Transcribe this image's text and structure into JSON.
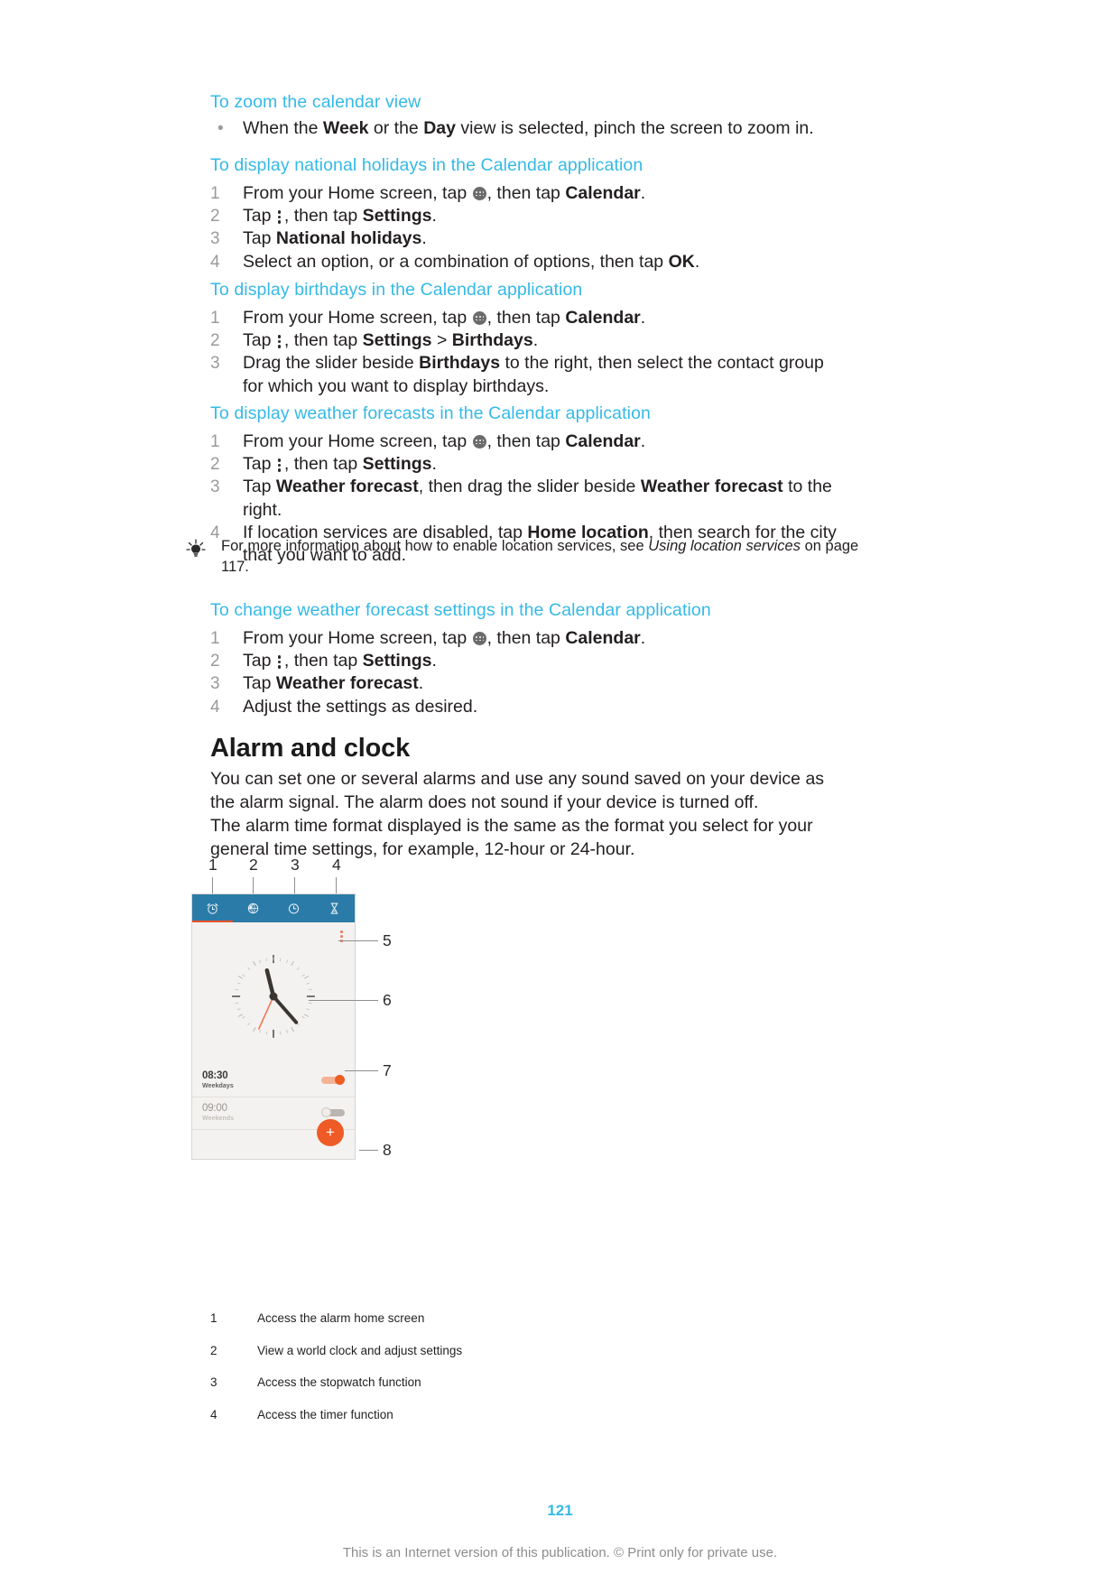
{
  "colors": {
    "heading_teal": "#36b9e6",
    "body_text": "#231f20",
    "step_number": "#9a9a9a",
    "phone_tabbar": "#2b7ba8",
    "accent_orange": "#ee5b26",
    "footer_gray": "#8d8d8d"
  },
  "sections": [
    {
      "id": "zoom-calendar-view",
      "heading": "To zoom the calendar view",
      "list_type": "bullet",
      "steps": [
        {
          "parts": [
            {
              "t": "text",
              "v": "When the "
            },
            {
              "t": "bold",
              "v": "Week"
            },
            {
              "t": "text",
              "v": " or the "
            },
            {
              "t": "bold",
              "v": "Day"
            },
            {
              "t": "text",
              "v": " view is selected, pinch the screen to zoom in."
            }
          ]
        }
      ]
    },
    {
      "id": "national-holidays",
      "heading": "To display national holidays in the Calendar application",
      "list_type": "numbered",
      "steps": [
        {
          "num": "1",
          "parts": [
            {
              "t": "text",
              "v": "From your Home screen, tap "
            },
            {
              "t": "icon",
              "v": "app-grid-icon"
            },
            {
              "t": "text",
              "v": ", then tap "
            },
            {
              "t": "bold",
              "v": "Calendar"
            },
            {
              "t": "text",
              "v": "."
            }
          ]
        },
        {
          "num": "2",
          "parts": [
            {
              "t": "text",
              "v": "Tap "
            },
            {
              "t": "icon",
              "v": "overflow-menu-icon"
            },
            {
              "t": "text",
              "v": ", then tap "
            },
            {
              "t": "bold",
              "v": "Settings"
            },
            {
              "t": "text",
              "v": "."
            }
          ]
        },
        {
          "num": "3",
          "parts": [
            {
              "t": "text",
              "v": "Tap "
            },
            {
              "t": "bold",
              "v": "National holidays"
            },
            {
              "t": "text",
              "v": "."
            }
          ]
        },
        {
          "num": "4",
          "parts": [
            {
              "t": "text",
              "v": "Select an option, or a combination of options, then tap "
            },
            {
              "t": "bold",
              "v": "OK"
            },
            {
              "t": "text",
              "v": "."
            }
          ]
        }
      ]
    },
    {
      "id": "birthdays",
      "heading": "To display birthdays in the Calendar application",
      "list_type": "numbered",
      "steps": [
        {
          "num": "1",
          "parts": [
            {
              "t": "text",
              "v": "From your Home screen, tap "
            },
            {
              "t": "icon",
              "v": "app-grid-icon"
            },
            {
              "t": "text",
              "v": ", then tap "
            },
            {
              "t": "bold",
              "v": "Calendar"
            },
            {
              "t": "text",
              "v": "."
            }
          ]
        },
        {
          "num": "2",
          "parts": [
            {
              "t": "text",
              "v": "Tap "
            },
            {
              "t": "icon",
              "v": "overflow-menu-icon"
            },
            {
              "t": "text",
              "v": ", then tap "
            },
            {
              "t": "bold",
              "v": "Settings"
            },
            {
              "t": "text",
              "v": " > "
            },
            {
              "t": "bold",
              "v": "Birthdays"
            },
            {
              "t": "text",
              "v": "."
            }
          ]
        },
        {
          "num": "3",
          "parts": [
            {
              "t": "text",
              "v": "Drag the slider beside "
            },
            {
              "t": "bold",
              "v": "Birthdays"
            },
            {
              "t": "text",
              "v": " to the right, then select the contact group for which you want to display birthdays."
            }
          ]
        }
      ]
    },
    {
      "id": "weather-forecasts",
      "heading": "To display weather forecasts in the Calendar application",
      "list_type": "numbered",
      "steps": [
        {
          "num": "1",
          "parts": [
            {
              "t": "text",
              "v": "From your Home screen, tap "
            },
            {
              "t": "icon",
              "v": "app-grid-icon"
            },
            {
              "t": "text",
              "v": ", then tap "
            },
            {
              "t": "bold",
              "v": "Calendar"
            },
            {
              "t": "text",
              "v": "."
            }
          ]
        },
        {
          "num": "2",
          "parts": [
            {
              "t": "text",
              "v": "Tap "
            },
            {
              "t": "icon",
              "v": "overflow-menu-icon"
            },
            {
              "t": "text",
              "v": ", then tap "
            },
            {
              "t": "bold",
              "v": "Settings"
            },
            {
              "t": "text",
              "v": "."
            }
          ]
        },
        {
          "num": "3",
          "parts": [
            {
              "t": "text",
              "v": "Tap "
            },
            {
              "t": "bold",
              "v": "Weather forecast"
            },
            {
              "t": "text",
              "v": ", then drag the slider beside "
            },
            {
              "t": "bold",
              "v": "Weather forecast"
            },
            {
              "t": "text",
              "v": " to the right."
            }
          ]
        },
        {
          "num": "4",
          "parts": [
            {
              "t": "text",
              "v": "If location services are disabled, tap "
            },
            {
              "t": "bold",
              "v": "Home location"
            },
            {
              "t": "text",
              "v": ", then search for the city that you want to add."
            }
          ]
        }
      ]
    },
    {
      "id": "change-weather-forecast-settings",
      "heading": "To change weather forecast settings in the Calendar application",
      "list_type": "numbered",
      "steps": [
        {
          "num": "1",
          "parts": [
            {
              "t": "text",
              "v": "From your Home screen, tap "
            },
            {
              "t": "icon",
              "v": "app-grid-icon"
            },
            {
              "t": "text",
              "v": ", then tap "
            },
            {
              "t": "bold",
              "v": "Calendar"
            },
            {
              "t": "text",
              "v": "."
            }
          ]
        },
        {
          "num": "2",
          "parts": [
            {
              "t": "text",
              "v": "Tap "
            },
            {
              "t": "icon",
              "v": "overflow-menu-icon"
            },
            {
              "t": "text",
              "v": ", then tap "
            },
            {
              "t": "bold",
              "v": "Settings"
            },
            {
              "t": "text",
              "v": "."
            }
          ]
        },
        {
          "num": "3",
          "parts": [
            {
              "t": "text",
              "v": "Tap "
            },
            {
              "t": "bold",
              "v": "Weather forecast"
            },
            {
              "t": "text",
              "v": "."
            }
          ]
        },
        {
          "num": "4",
          "parts": [
            {
              "t": "text",
              "v": "Adjust the settings as desired."
            }
          ]
        }
      ]
    }
  ],
  "tip": {
    "icon": "lightbulb-icon",
    "parts": [
      {
        "t": "text",
        "v": "For more information about how to enable location services, see "
      },
      {
        "t": "italic",
        "v": "Using location services"
      },
      {
        "t": "text",
        "v": " on page 117."
      }
    ]
  },
  "alarm_section": {
    "title": "Alarm and clock",
    "paragraph_1": "You can set one or several alarms and use any sound saved on your device as the alarm signal. The alarm does not sound if your device is turned off.",
    "paragraph_2": "The alarm time format displayed is the same as the format you select for your general time settings, for example, 12-hour or 24-hour."
  },
  "figure": {
    "callout_numbers_top": [
      "1",
      "2",
      "3",
      "4"
    ],
    "callout_numbers_right": [
      "5",
      "6",
      "7",
      "8"
    ],
    "tabs": [
      {
        "num": "1",
        "icon": "alarm-clock-icon",
        "selected": true
      },
      {
        "num": "2",
        "icon": "world-clock-icon",
        "selected": false
      },
      {
        "num": "3",
        "icon": "stopwatch-icon",
        "selected": false
      },
      {
        "num": "4",
        "icon": "hourglass-timer-icon",
        "selected": false
      }
    ],
    "overflow_menu_icon": "overflow-menu-icon",
    "clock_icon": "analog-clock-face",
    "alarms": [
      {
        "time": "08:30",
        "repeat": "Weekdays",
        "enabled": true
      },
      {
        "time": "09:00",
        "repeat": "Weekends",
        "enabled": false
      }
    ],
    "add_button_label": "+"
  },
  "legend": {
    "rows": [
      {
        "num": "1",
        "text": "Access the alarm home screen"
      },
      {
        "num": "2",
        "text": "View a world clock and adjust settings"
      },
      {
        "num": "3",
        "text": "Access the stopwatch function"
      },
      {
        "num": "4",
        "text": "Access the timer function"
      }
    ]
  },
  "footer": {
    "page_number": "121",
    "notice": "This is an Internet version of this publication. © Print only for private use."
  }
}
